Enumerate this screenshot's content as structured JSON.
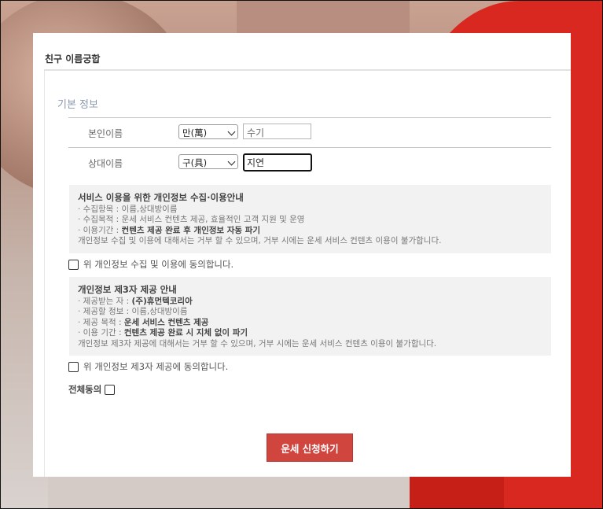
{
  "panel": {
    "title": "친구 이름궁합"
  },
  "basic_info": {
    "section_title": "기본 정보",
    "self": {
      "label": "본인이름",
      "surname": "만(萬)",
      "given_name": "수기"
    },
    "partner": {
      "label": "상대이름",
      "surname": "구(具)",
      "given_name": "지연"
    }
  },
  "privacy_collect": {
    "heading": "서비스 이용을 위한 개인정보 수집·이용안내",
    "item_label": "· 수집항목 : ",
    "item_value": "이름,상대방이름",
    "purpose_label": "· 수집목적 : ",
    "purpose_value": "운세 서비스 컨텐츠 제공, 효율적인 고객 지원 및 운영",
    "period_label": "· 이용기간 : ",
    "period_value": "컨텐츠 제공 완료 후 개인정보 자동 파기",
    "notice": "개인정보 수집 및 이용에 대해서는 거부 할 수 있으며, 거부 시에는 운세 서비스 컨텐츠 이용이 불가합니다.",
    "agree_label": "위 개인정보 수집 및 이용에 동의합니다."
  },
  "privacy_third_party": {
    "heading": "개인정보 제3자 제공 안내",
    "recipient_label": "· 제공받는 자 : ",
    "recipient_value": "(주)휴먼텍코리아",
    "info_label": "· 제공할 정보 : ",
    "info_value": "이름,상대방이름",
    "purpose_label": "· 제공 목적 : ",
    "purpose_value": "운세 서비스 컨텐츠 제공",
    "period_label": "· 이용 기간 : ",
    "period_value": "컨텐츠 제공 완료 시 지체 없이 파기",
    "notice": "개인정보 제3자 제공에 대해서는 거부 할 수 있으며, 거부 시에는 운세 서비스 컨텐츠 이용이 불가합니다.",
    "agree_label": "위 개인정보 제3자 제공에 동의합니다."
  },
  "agree_all_label": "전체동의",
  "submit_label": "운세 신청하기",
  "colors": {
    "button": "#d1453f",
    "section_title": "#8a98ad",
    "info_bg": "#f2f2f2"
  }
}
